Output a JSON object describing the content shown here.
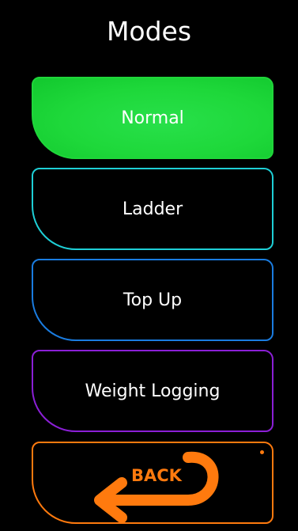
{
  "screen": {
    "title": "Modes"
  },
  "modes": {
    "normal": {
      "label": "Normal",
      "color": "#1ed83a"
    },
    "ladder": {
      "label": "Ladder",
      "color": "#1ecfd6"
    },
    "top_up": {
      "label": "Top Up",
      "color": "#1a7ce0"
    },
    "weight_logging": {
      "label": "Weight Logging",
      "color": "#8b1fd6"
    }
  },
  "back": {
    "label": "BACK",
    "icon": "back-arrow-icon",
    "color": "#ff7a0e"
  }
}
